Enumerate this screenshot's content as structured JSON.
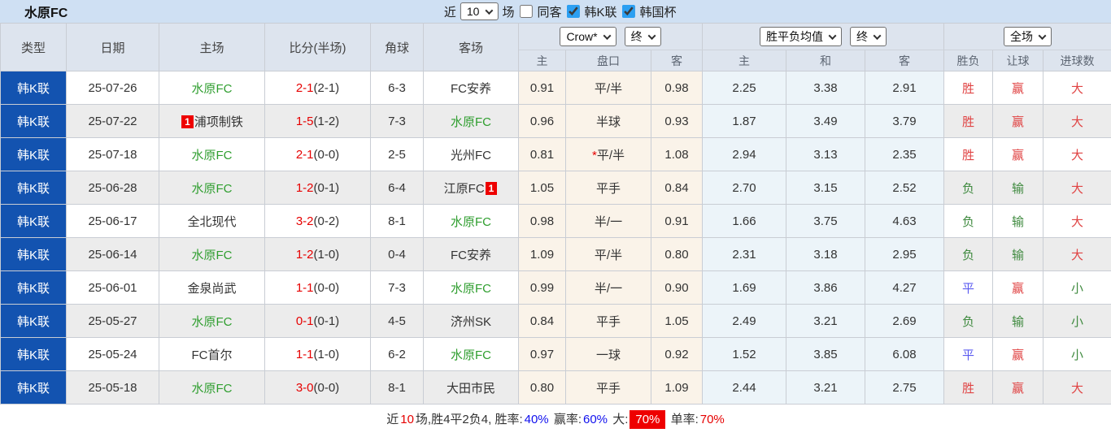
{
  "title": "水原FC",
  "toolbar": {
    "recent_label": "近",
    "matches_value": "10",
    "matches_label": "场",
    "same_venue_label": "同客",
    "same_venue_checked": false,
    "league_label": "韩K联",
    "league_checked": true,
    "cup_label": "韩国杯",
    "cup_checked": true
  },
  "header": {
    "type": "类型",
    "date": "日期",
    "home": "主场",
    "score": "比分(半场)",
    "corner": "角球",
    "away": "客场",
    "odds_book": "Crow*",
    "odds_stage": "终",
    "asia_home": "主",
    "asia_line": "盘口",
    "asia_away": "客",
    "europe_book": "胜平负均值",
    "europe_stage": "终",
    "eu_home": "主",
    "eu_draw": "和",
    "eu_away": "客",
    "scope": "全场",
    "result": "胜负",
    "handicap": "让球",
    "goals": "进球数"
  },
  "colors": {
    "type_cell_bg": "#1353b0",
    "self_team_green": "#2f9e2f",
    "score_red": "#e60000",
    "win_red": "#e04343",
    "lose_green": "#3f8a3f",
    "draw_blue": "#5b5bf0",
    "summary_blue": "#1010ee",
    "summary_red_bg": "#ee0000",
    "asia_bg": "#faf3e9",
    "europe_bg": "#ecf4f9"
  },
  "rows": [
    {
      "league": "韩K联",
      "date": "25-07-26",
      "home": "水原FC",
      "hs": true,
      "hb": "",
      "score": "2-1",
      "half": "(2-1)",
      "corner": "6-3",
      "away": "FC安养",
      "as": false,
      "ab": "",
      "ah": "0.91",
      "line": "平/半",
      "star": false,
      "aa": "0.98",
      "eh": "2.25",
      "ed": "3.38",
      "ea": "2.91",
      "res": "胜",
      "rc": "red",
      "han": "赢",
      "hc": "red",
      "goal": "大",
      "gc": "red"
    },
    {
      "league": "韩K联",
      "date": "25-07-22",
      "home": "浦项制铁",
      "hs": false,
      "hb": "1",
      "score": "1-5",
      "half": "(1-2)",
      "corner": "7-3",
      "away": "水原FC",
      "as": true,
      "ab": "",
      "ah": "0.96",
      "line": "半球",
      "star": false,
      "aa": "0.93",
      "eh": "1.87",
      "ed": "3.49",
      "ea": "3.79",
      "res": "胜",
      "rc": "red",
      "han": "赢",
      "hc": "red",
      "goal": "大",
      "gc": "red"
    },
    {
      "league": "韩K联",
      "date": "25-07-18",
      "home": "水原FC",
      "hs": true,
      "hb": "",
      "score": "2-1",
      "half": "(0-0)",
      "corner": "2-5",
      "away": "光州FC",
      "as": false,
      "ab": "",
      "ah": "0.81",
      "line": "平/半",
      "star": true,
      "aa": "1.08",
      "eh": "2.94",
      "ed": "3.13",
      "ea": "2.35",
      "res": "胜",
      "rc": "red",
      "han": "赢",
      "hc": "red",
      "goal": "大",
      "gc": "red"
    },
    {
      "league": "韩K联",
      "date": "25-06-28",
      "home": "水原FC",
      "hs": true,
      "hb": "",
      "score": "1-2",
      "half": "(0-1)",
      "corner": "6-4",
      "away": "江原FC",
      "as": false,
      "ab": "1",
      "ah": "1.05",
      "line": "平手",
      "star": false,
      "aa": "0.84",
      "eh": "2.70",
      "ed": "3.15",
      "ea": "2.52",
      "res": "负",
      "rc": "green",
      "han": "输",
      "hc": "green",
      "goal": "大",
      "gc": "red"
    },
    {
      "league": "韩K联",
      "date": "25-06-17",
      "home": "全北现代",
      "hs": false,
      "hb": "",
      "score": "3-2",
      "half": "(0-2)",
      "corner": "8-1",
      "away": "水原FC",
      "as": true,
      "ab": "",
      "ah": "0.98",
      "line": "半/一",
      "star": false,
      "aa": "0.91",
      "eh": "1.66",
      "ed": "3.75",
      "ea": "4.63",
      "res": "负",
      "rc": "green",
      "han": "输",
      "hc": "green",
      "goal": "大",
      "gc": "red"
    },
    {
      "league": "韩K联",
      "date": "25-06-14",
      "home": "水原FC",
      "hs": true,
      "hb": "",
      "score": "1-2",
      "half": "(1-0)",
      "corner": "0-4",
      "away": "FC安养",
      "as": false,
      "ab": "",
      "ah": "1.09",
      "line": "平/半",
      "star": false,
      "aa": "0.80",
      "eh": "2.31",
      "ed": "3.18",
      "ea": "2.95",
      "res": "负",
      "rc": "green",
      "han": "输",
      "hc": "green",
      "goal": "大",
      "gc": "red"
    },
    {
      "league": "韩K联",
      "date": "25-06-01",
      "home": "金泉尚武",
      "hs": false,
      "hb": "",
      "score": "1-1",
      "half": "(0-0)",
      "corner": "7-3",
      "away": "水原FC",
      "as": true,
      "ab": "",
      "ah": "0.99",
      "line": "半/一",
      "star": false,
      "aa": "0.90",
      "eh": "1.69",
      "ed": "3.86",
      "ea": "4.27",
      "res": "平",
      "rc": "blue",
      "han": "赢",
      "hc": "red",
      "goal": "小",
      "gc": "green"
    },
    {
      "league": "韩K联",
      "date": "25-05-27",
      "home": "水原FC",
      "hs": true,
      "hb": "",
      "score": "0-1",
      "half": "(0-1)",
      "corner": "4-5",
      "away": "济州SK",
      "as": false,
      "ab": "",
      "ah": "0.84",
      "line": "平手",
      "star": false,
      "aa": "1.05",
      "eh": "2.49",
      "ed": "3.21",
      "ea": "2.69",
      "res": "负",
      "rc": "green",
      "han": "输",
      "hc": "green",
      "goal": "小",
      "gc": "green"
    },
    {
      "league": "韩K联",
      "date": "25-05-24",
      "home": "FC首尔",
      "hs": false,
      "hb": "",
      "score": "1-1",
      "half": "(1-0)",
      "corner": "6-2",
      "away": "水原FC",
      "as": true,
      "ab": "",
      "ah": "0.97",
      "line": "一球",
      "star": false,
      "aa": "0.92",
      "eh": "1.52",
      "ed": "3.85",
      "ea": "6.08",
      "res": "平",
      "rc": "blue",
      "han": "赢",
      "hc": "red",
      "goal": "小",
      "gc": "green"
    },
    {
      "league": "韩K联",
      "date": "25-05-18",
      "home": "水原FC",
      "hs": true,
      "hb": "",
      "score": "3-0",
      "half": "(0-0)",
      "corner": "8-1",
      "away": "大田市民",
      "as": false,
      "ab": "",
      "ah": "0.80",
      "line": "平手",
      "star": false,
      "aa": "1.09",
      "eh": "2.44",
      "ed": "3.21",
      "ea": "2.75",
      "res": "胜",
      "rc": "red",
      "han": "赢",
      "hc": "red",
      "goal": "大",
      "gc": "red"
    }
  ],
  "summary": {
    "segments": [
      {
        "t": "近",
        "c": "dark"
      },
      {
        "t": "10",
        "c": "red"
      },
      {
        "t": "场,胜4平2负4, 胜率:",
        "c": "dark"
      },
      {
        "t": "40%",
        "c": "blue"
      },
      {
        "t": " 赢率:",
        "c": "dark"
      },
      {
        "t": "60%",
        "c": "blue"
      },
      {
        "t": " 大:",
        "c": "dark"
      },
      {
        "t": "70%",
        "c": "redbox"
      },
      {
        "t": " 单率:",
        "c": "dark"
      },
      {
        "t": "70%",
        "c": "red"
      }
    ]
  }
}
